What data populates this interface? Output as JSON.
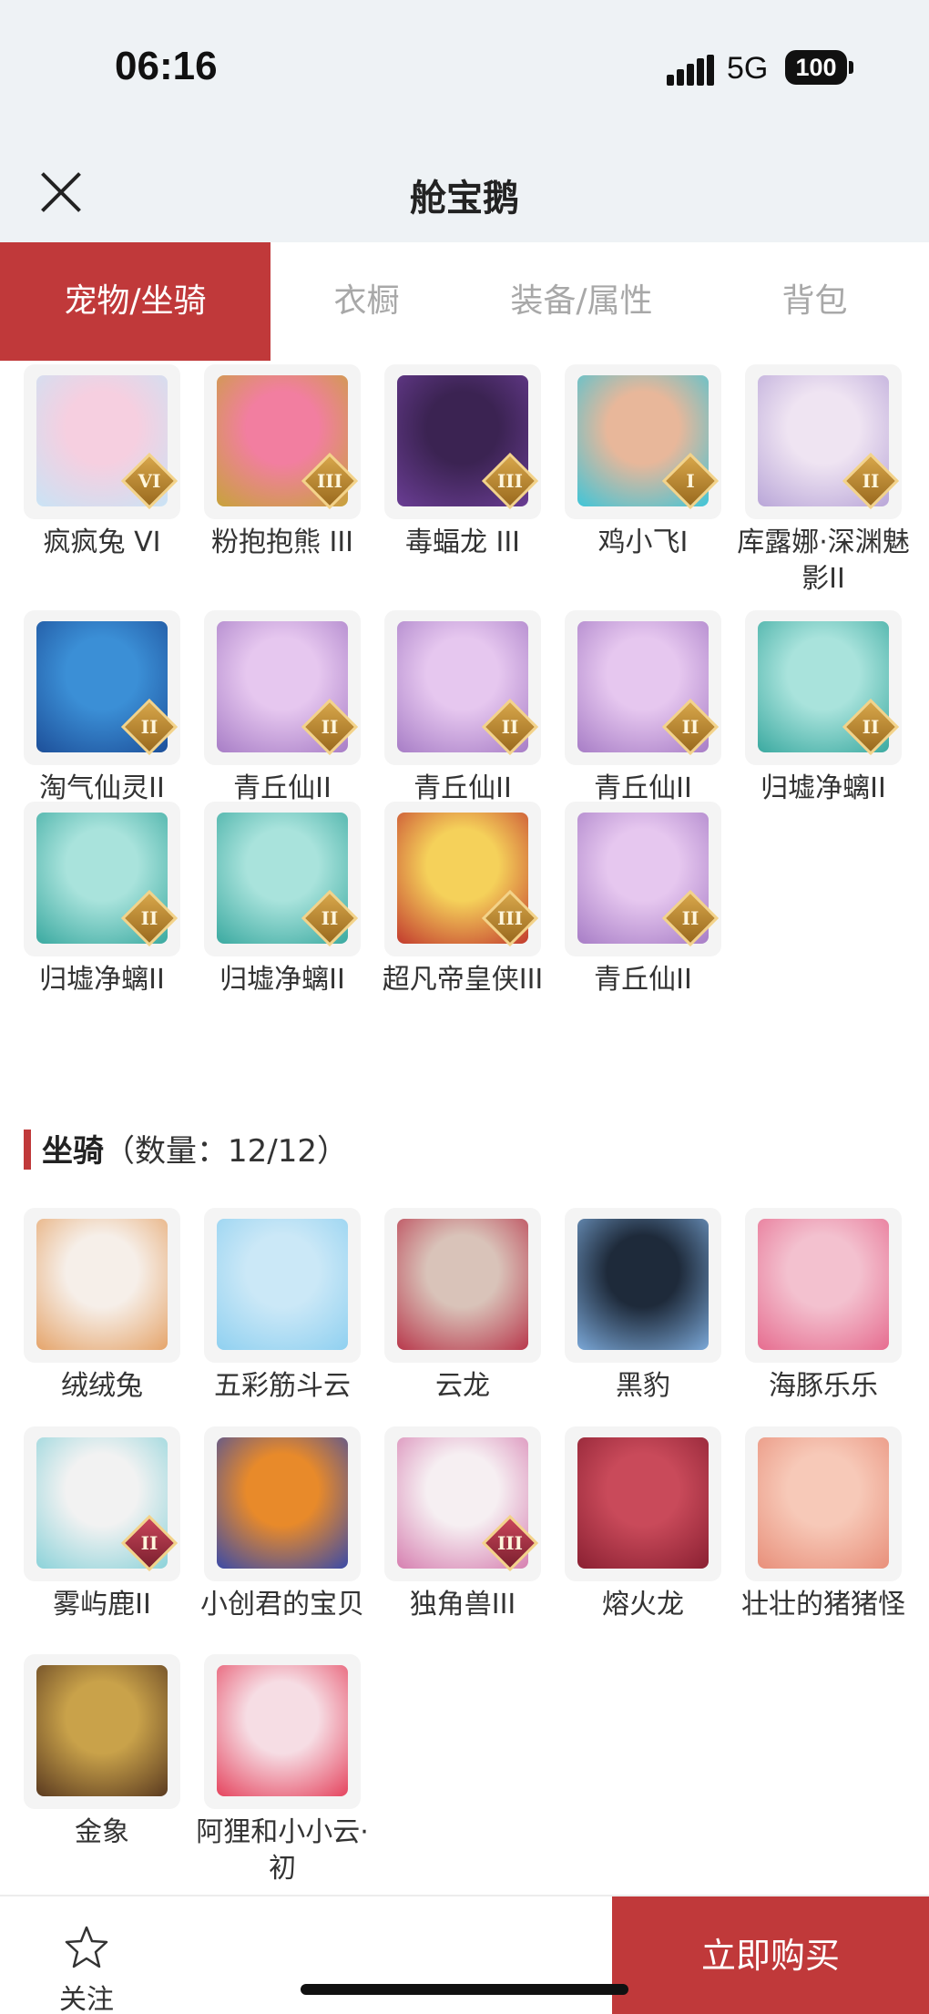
{
  "status_bar": {
    "time": "06:16",
    "network": "5G",
    "battery": "100"
  },
  "header": {
    "title": "舱宝鹅"
  },
  "tabs": [
    {
      "label": "宠物/坐骑",
      "active": true
    },
    {
      "label": "衣橱",
      "active": false
    },
    {
      "label": "装备/属性",
      "active": false
    },
    {
      "label": "背包",
      "active": false
    }
  ],
  "pets": [
    {
      "name": "疯疯兔 VI",
      "tier": "VI"
    },
    {
      "name": "粉抱抱熊 III",
      "tier": "III"
    },
    {
      "name": "毒蝠龙 III",
      "tier": "III"
    },
    {
      "name": "鸡小飞I",
      "tier": "I"
    },
    {
      "name": "库露娜·深渊魅影II",
      "tier": "II"
    },
    {
      "name": "淘气仙灵II",
      "tier": "II"
    },
    {
      "name": "青丘仙II",
      "tier": "II"
    },
    {
      "name": "青丘仙II",
      "tier": "II"
    },
    {
      "name": "青丘仙II",
      "tier": "II"
    },
    {
      "name": "归墟净螭II",
      "tier": "II"
    },
    {
      "name": "归墟净螭II",
      "tier": "II"
    },
    {
      "name": "归墟净螭II",
      "tier": "II"
    },
    {
      "name": "超凡帝皇侠III",
      "tier": "III"
    },
    {
      "name": "青丘仙II",
      "tier": "II"
    }
  ],
  "mounts_section": {
    "title": "坐骑",
    "count": "（数量：12/12）"
  },
  "mounts": [
    {
      "name": "绒绒兔",
      "tier": ""
    },
    {
      "name": "五彩筋斗云",
      "tier": ""
    },
    {
      "name": "云龙",
      "tier": ""
    },
    {
      "name": "黑豹",
      "tier": ""
    },
    {
      "name": "海豚乐乐",
      "tier": ""
    },
    {
      "name": "雾屿鹿II",
      "tier": "II"
    },
    {
      "name": "小创君的宝贝",
      "tier": ""
    },
    {
      "name": "独角兽III",
      "tier": "III"
    },
    {
      "name": "熔火龙",
      "tier": ""
    },
    {
      "name": "壮壮的猪猪怪",
      "tier": ""
    },
    {
      "name": "金象",
      "tier": ""
    },
    {
      "name": "阿狸和小小云·初",
      "tier": ""
    }
  ],
  "bottom_bar": {
    "follow_label": "关注",
    "buy_label": "立即购买"
  },
  "colors": {
    "accent": "#c0393a",
    "tile_bg": "#f4f4f4"
  }
}
